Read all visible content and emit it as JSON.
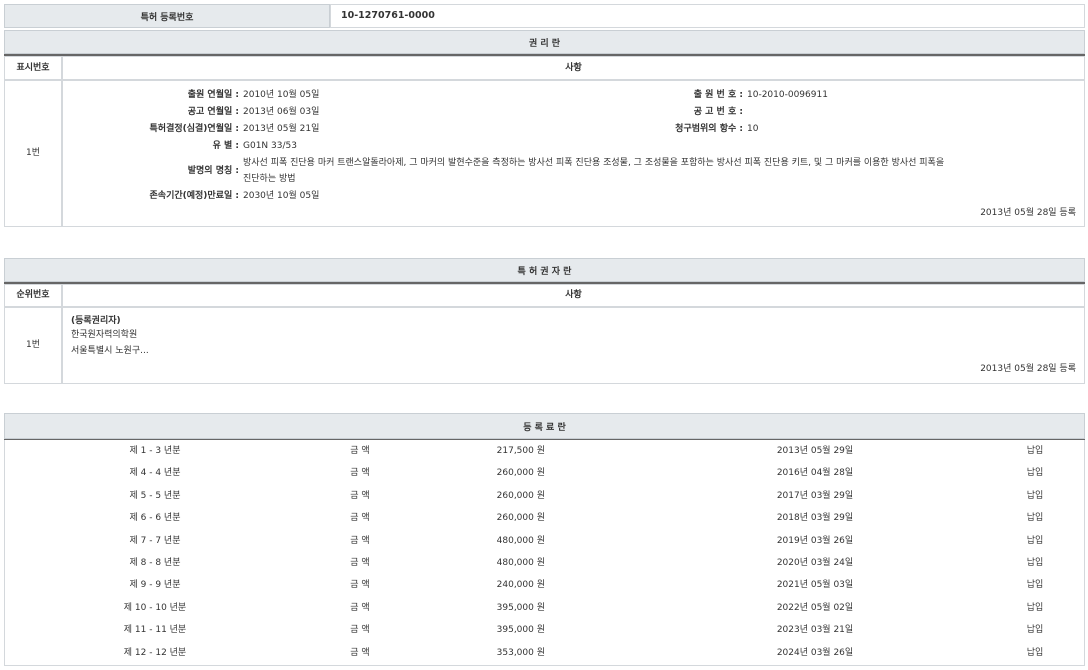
{
  "reg": {
    "label": "특허 등록번호",
    "value": "10-1270761-0000"
  },
  "rights": {
    "title": "권 리 란",
    "col1": "표시번호",
    "col2": "사항",
    "index": "1번",
    "fields": {
      "app_date_label": "출원 연월일 :",
      "app_date": "2010년 10월 05일",
      "app_no_label": "출 원 번 호 :",
      "app_no": "10-2010-0096911",
      "pub_date_label": "공고 연월일 :",
      "pub_date": "2013년 06월 03일",
      "pub_no_label": "공 고 번 호 :",
      "pub_no": "",
      "decision_label": "특허결정(심결)연월일 :",
      "decision": "2013년 05월 21일",
      "claims_label": "청구범위의 항수 :",
      "claims": "10",
      "type_label": "유 별 :",
      "type": "G01N 33/53",
      "title_label": "발명의 명칭 :",
      "title_line1": "방사선 피폭 진단용 마커 트랜스알돌라아제, 그 마커의 발현수준을 측정하는 방사선 피폭 진단용 조성물, 그 조성물을 포함하는 방사선 피폭 진단용 키트, 및 그 마커를 이용한 방사선 피폭을",
      "title_line2": "진단하는 방법",
      "expiry_label": "존속기간(예정)만료일 :",
      "expiry": "2030년 10월 05일"
    },
    "registered": "2013년 05월 28일 등록"
  },
  "holders": {
    "title": "특 허 권 자 란",
    "col1": "순위번호",
    "col2": "사항",
    "index": "1번",
    "role": "(등록권리자)",
    "name": "한국원자력의학원",
    "address": "서울특별시 노원구...",
    "registered": "2013년 05월 28일 등록"
  },
  "fees": {
    "title": "등 록 료 란",
    "amount_label": "금 액",
    "rows": [
      {
        "period": "제 1 - 3 년분",
        "amount": "217,500 원",
        "date": "2013년 05월 29일",
        "status": "납입"
      },
      {
        "period": "제 4 - 4 년분",
        "amount": "260,000 원",
        "date": "2016년 04월 28일",
        "status": "납입"
      },
      {
        "period": "제 5 - 5 년분",
        "amount": "260,000 원",
        "date": "2017년 03월 29일",
        "status": "납입"
      },
      {
        "period": "제 6 - 6 년분",
        "amount": "260,000 원",
        "date": "2018년 03월 29일",
        "status": "납입"
      },
      {
        "period": "제 7 - 7 년분",
        "amount": "480,000 원",
        "date": "2019년 03월 26일",
        "status": "납입"
      },
      {
        "period": "제 8 - 8 년분",
        "amount": "480,000 원",
        "date": "2020년 03월 24일",
        "status": "납입"
      },
      {
        "period": "제 9 - 9 년분",
        "amount": "240,000 원",
        "date": "2021년 05월 03일",
        "status": "납입"
      },
      {
        "period": "제 10 - 10 년분",
        "amount": "395,000 원",
        "date": "2022년 05월 02일",
        "status": "납입"
      },
      {
        "period": "제 11 - 11 년분",
        "amount": "395,000 원",
        "date": "2023년 03월 21일",
        "status": "납입"
      },
      {
        "period": "제 12 - 12 년분",
        "amount": "353,000 원",
        "date": "2024년 03월 26일",
        "status": "납입"
      }
    ]
  }
}
